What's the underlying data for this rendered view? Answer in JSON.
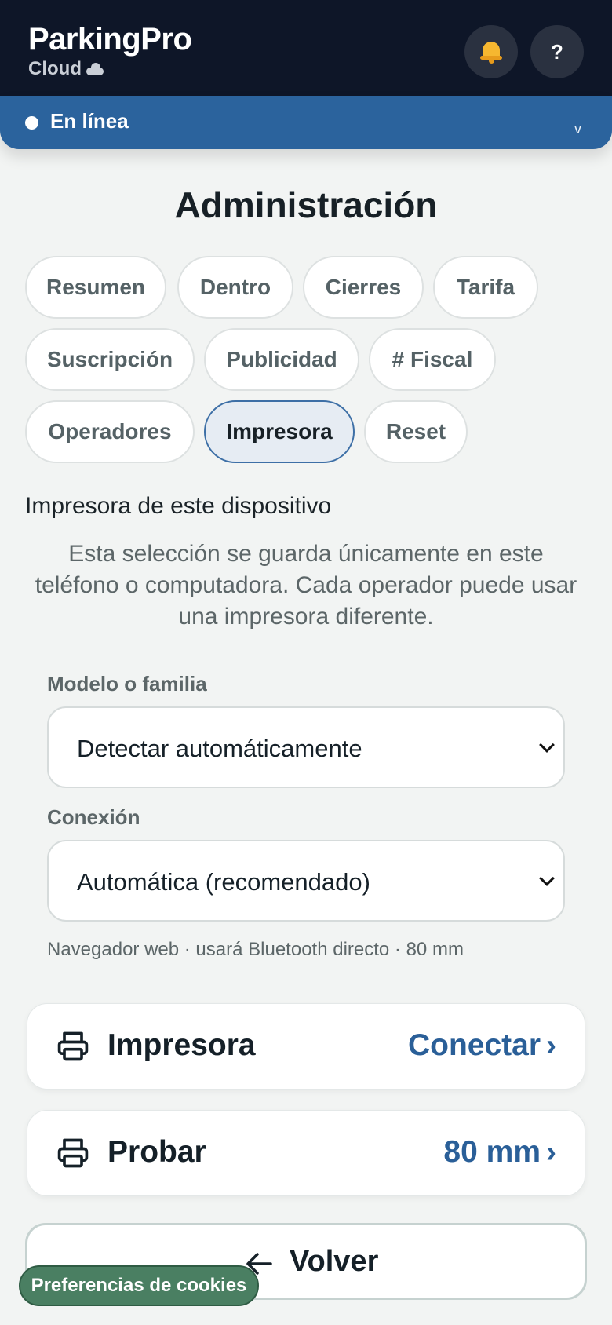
{
  "app": {
    "title": "ParkingPro",
    "subtitle": "Cloud",
    "help_label": "?"
  },
  "status": {
    "label": "En línea",
    "chevron": "v"
  },
  "page": {
    "title": "Administración"
  },
  "tabs": [
    {
      "label": "Resumen",
      "active": false
    },
    {
      "label": "Dentro",
      "active": false
    },
    {
      "label": "Cierres",
      "active": false
    },
    {
      "label": "Tarifa",
      "active": false
    },
    {
      "label": "Suscripción",
      "active": false
    },
    {
      "label": "Publicidad",
      "active": false
    },
    {
      "label": "# Fiscal",
      "active": false
    },
    {
      "label": "Operadores",
      "active": false
    },
    {
      "label": "Impresora",
      "active": true
    },
    {
      "label": "Reset",
      "active": false
    }
  ],
  "printer_section": {
    "title": "Impresora de este dispositivo",
    "description": "Esta selección se guarda únicamente en este teléfono o computadora. Cada operador puede usar una impresora diferente.",
    "model_label": "Modelo o familia",
    "model_value": "Detectar automáticamente",
    "connection_label": "Conexión",
    "connection_value": "Automática (recomendado)",
    "hint": "Navegador web · usará Bluetooth directo · 80 mm"
  },
  "actions": [
    {
      "label": "Impresora",
      "value": "Conectar",
      "chevron": "›",
      "icon": "printer-icon"
    },
    {
      "label": "Probar",
      "value": "80 mm",
      "chevron": "›",
      "icon": "printer-icon"
    }
  ],
  "back": {
    "label": "Volver",
    "icon": "arrow-left-icon"
  },
  "cookies": {
    "label": "Preferencias de cookies"
  },
  "colors": {
    "header_bg": "#0e1628",
    "status_bg": "#2b639d",
    "accent": "#2a5f98",
    "cookie_bg": "#4a7f62",
    "bell": "#f6b730"
  }
}
